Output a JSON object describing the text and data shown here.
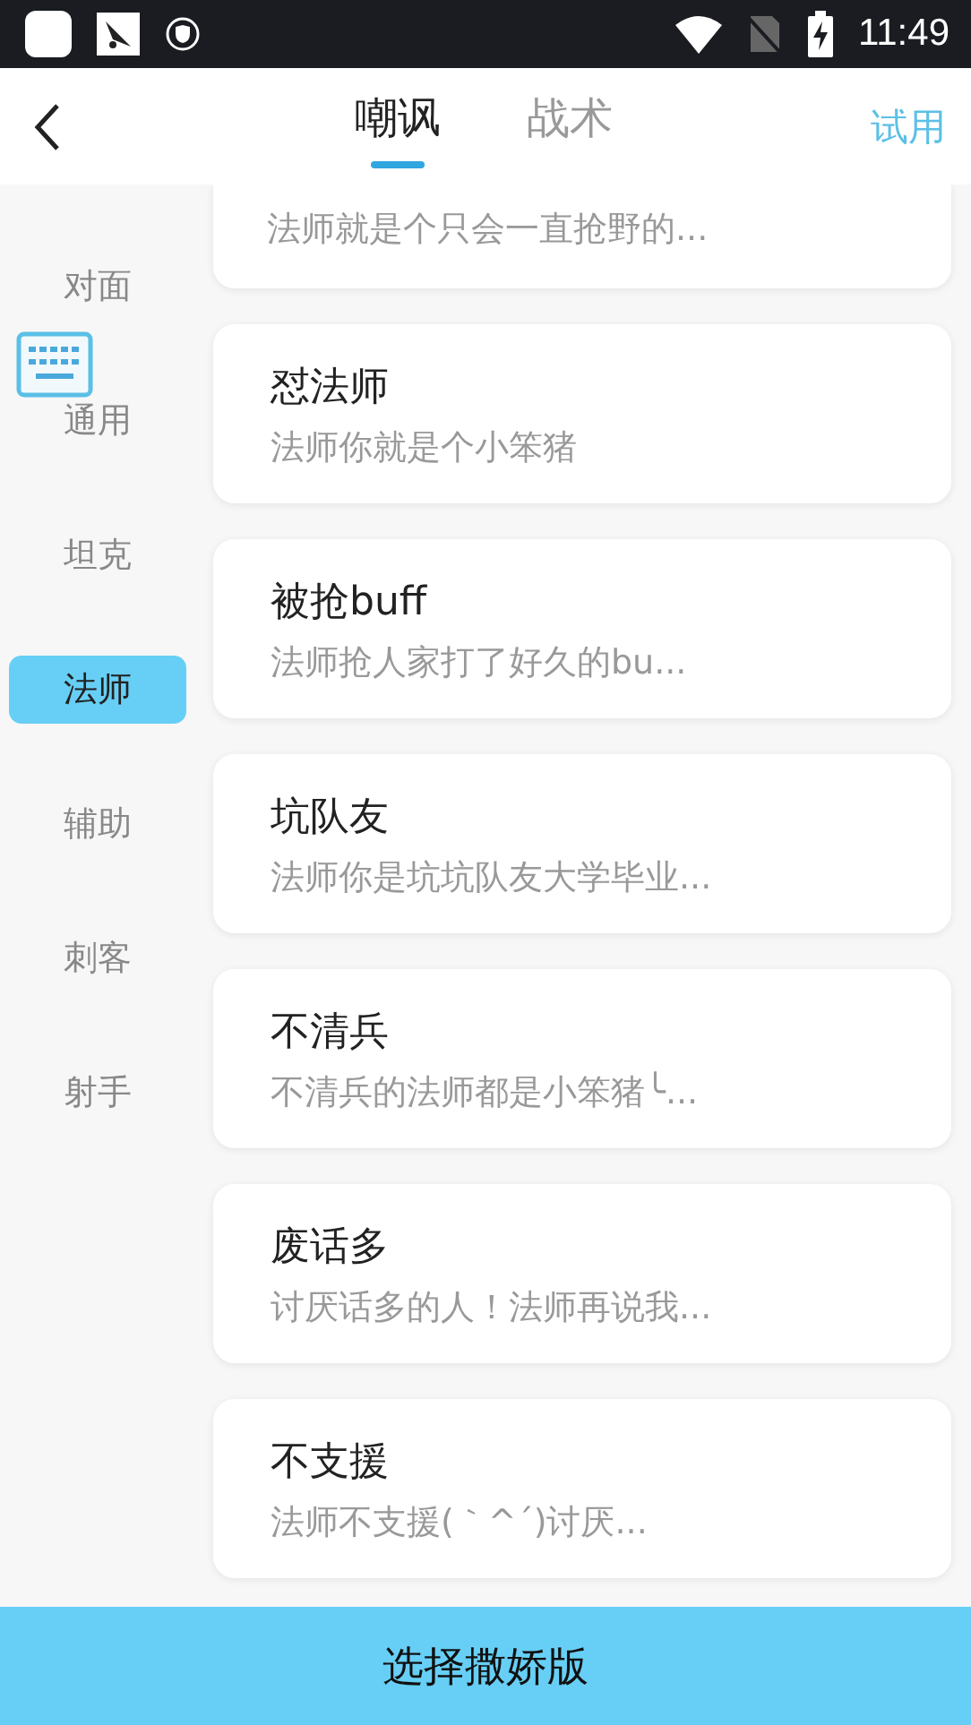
{
  "status_bar": {
    "time": "11:49"
  },
  "header": {
    "tabs": [
      {
        "label": "嘲讽",
        "selected": true
      },
      {
        "label": "战术",
        "selected": false
      }
    ],
    "action": "试用"
  },
  "sidebar": {
    "items": [
      {
        "label": "对面",
        "selected": false
      },
      {
        "label": "通用",
        "selected": false
      },
      {
        "label": "坦克",
        "selected": false
      },
      {
        "label": "法师",
        "selected": true
      },
      {
        "label": "辅助",
        "selected": false
      },
      {
        "label": "刺客",
        "selected": false
      },
      {
        "label": "射手",
        "selected": false
      }
    ]
  },
  "cards": [
    {
      "description": "法师就是个只会一直抢野的..."
    },
    {
      "title": "怼法师",
      "description": "法师你就是个小笨猪"
    },
    {
      "title": "被抢buff",
      "description": "法师抢人家打了好久的bu..."
    },
    {
      "title": "坑队友",
      "description": "法师你是坑坑队友大学毕业..."
    },
    {
      "title": "不清兵",
      "description": "不清兵的法师都是小笨猪╰..."
    },
    {
      "title": "废话多",
      "description": "讨厌话多的人！法师再说我..."
    },
    {
      "title": "不支援",
      "description": "法师不支援(｀^´)讨厌..."
    }
  ],
  "bottom_button": "选择撒娇版"
}
